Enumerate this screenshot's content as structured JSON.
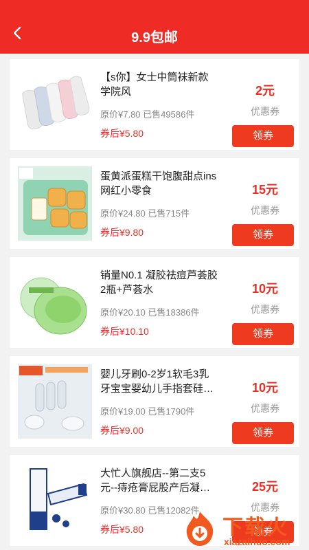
{
  "header": {
    "title": "9.9包邮",
    "back_icon": "chevron-left-icon"
  },
  "products": [
    {
      "name": "【s你】女士中筒袜新款学院风",
      "original_price": "原价¥7.80",
      "sold": "已售49586件",
      "after_coupon": "券后¥5.80",
      "coupon_value": "2元",
      "coupon_label": "优惠券",
      "button_label": "领券",
      "image": "socks-image"
    },
    {
      "name": "蛋黄派蛋糕干饱腹甜点ins网红小零食",
      "original_price": "原价¥24.80",
      "sold": "已售715件",
      "after_coupon": "券后¥9.80",
      "coupon_value": "15元",
      "coupon_label": "优惠券",
      "button_label": "领券",
      "image": "egg-cake-image"
    },
    {
      "name": "销量N0.1 凝胶祛痘芦荟胶2瓶+芦荟水",
      "original_price": "原价¥20.10",
      "sold": "已售18386件",
      "after_coupon": "券后¥10.10",
      "coupon_value": "10元",
      "coupon_label": "优惠券",
      "button_label": "领券",
      "image": "aloe-gel-image"
    },
    {
      "name": "婴儿牙刷0-2岁1软毛3乳牙宝宝婴幼儿手指套硅…",
      "original_price": "原价¥19.00",
      "sold": "已售1790件",
      "after_coupon": "券后¥9.00",
      "coupon_value": "10元",
      "coupon_label": "优惠券",
      "button_label": "领券",
      "image": "finger-toothbrush-image"
    },
    {
      "name": "大忙人旗舰店--第二支5元--痔疮膏屁股产后凝…",
      "original_price": "原价¥30.80",
      "sold": "已售12082件",
      "after_coupon": "券后¥5.80",
      "coupon_value": "25元",
      "coupon_label": "优惠券",
      "button_label": "领券",
      "image": "ointment-image"
    }
  ],
  "watermark": {
    "brand": "下载火",
    "site": "xiazaihuo.com"
  },
  "colors": {
    "accent": "#ee2b24",
    "button": "#ee3a1f"
  }
}
